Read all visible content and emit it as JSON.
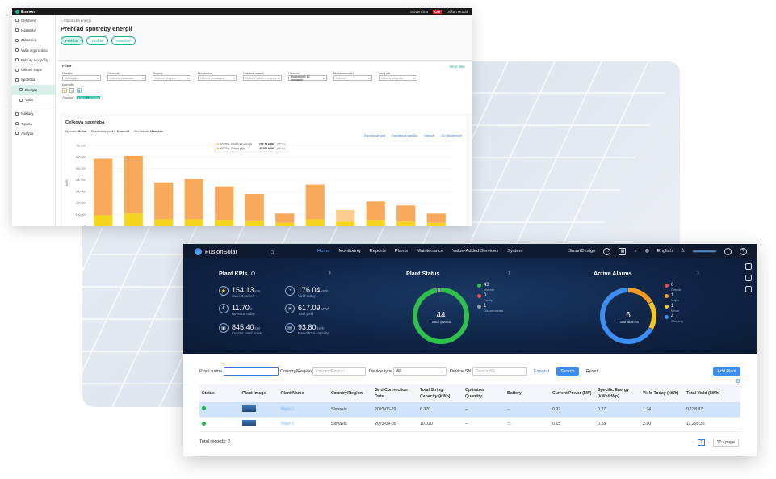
{
  "enmon": {
    "logo": "Enmon",
    "top_right": {
      "lang": "Slovenčina",
      "badge": "ON",
      "user": "Dušan Hudák"
    },
    "sidebar": [
      {
        "label": "Obľúbené"
      },
      {
        "label": "Nástenky"
      },
      {
        "label": "Zákazníci"
      },
      {
        "label": "Vaša organizácia"
      },
      {
        "label": "Faktúry a odpočty"
      },
      {
        "label": "Útlkové stupe"
      },
      {
        "label": "Spotreba"
      },
      {
        "label": "Energia"
      },
      {
        "label": "Voda"
      },
      {
        "label": "Nákłady"
      },
      {
        "label": "Toplota"
      },
      {
        "label": "Analýza"
      }
    ],
    "breadcrumb": "Spotreba energii",
    "title": "Prehľad spotreby energii",
    "tabs": [
      "Prehľad",
      "Využitie",
      "Mesačne"
    ],
    "filter": {
      "title": "Filter",
      "hide": "Skryť filter",
      "fields": [
        {
          "label": "Meradlo",
          "value": "Vyhľadajte..."
        },
        {
          "label": "Zákazník",
          "value": "Vyberte zákazníka"
        },
        {
          "label": "Skupiny",
          "value": "Vyberte skupinu"
        },
        {
          "label": "Prevádzka",
          "value": "Vyberte prevádzku"
        },
        {
          "label": "Odberné miesta",
          "value": "Vyberte odberné miesta"
        },
        {
          "label": "Obdobie",
          "value": "Posledných 12 mesiacov"
        },
        {
          "label": "Prevádzkovateľ",
          "value": "Vyberte"
        },
        {
          "label": "Zdroj dát",
          "value": "Vyberte zdroj dát"
        }
      ],
      "komodity_label": "Komodity",
      "obdobie_label": "Obdobie:",
      "obdobie_value": "1/2024 - 12/2024"
    },
    "card": {
      "title": "Celková spotreba",
      "options": [
        {
          "label": "Vypočet:",
          "value": "Suma"
        },
        {
          "label": "Rozdelenie podľa:",
          "value": "Komodít"
        },
        {
          "label": "Rozlíšenie:",
          "value": "Mesačne"
        }
      ],
      "actions": [
        "Exportovať graf",
        "Exportovať tabuľku",
        "Obnoviť",
        "Do oblúbených"
      ]
    },
    "chart_data": {
      "type": "bar",
      "ylabel": "kWh",
      "ylim": [
        0,
        700000
      ],
      "yticks": [
        "0",
        "100 000",
        "200 000",
        "300 000",
        "400 000",
        "500 000",
        "600 000",
        "700 000"
      ],
      "categories": [
        "1/2024",
        "2/2024",
        "3/2024",
        "4/2024",
        "5/2024",
        "6/2024",
        "7/2024",
        "8/2024",
        "9/2024",
        "10/2024",
        "11/2024",
        "12/2024"
      ],
      "series": [
        {
          "name": "Elektrická energia",
          "color": "#f5d51e",
          "values": [
            95000,
            110000,
            60000,
            60000,
            55000,
            50000,
            30000,
            60000,
            40000,
            55000,
            40000,
            30000
          ]
        },
        {
          "name": "Zemný plyn",
          "color": "#f8a95c",
          "values": [
            490000,
            500000,
            320000,
            350000,
            290000,
            230000,
            80000,
            300000,
            100000,
            160000,
            140000,
            80000
          ]
        }
      ],
      "tooltip": {
        "rows": [
          {
            "label": "9/2024 · Elektrická energia",
            "value": "222.78 kWh",
            "pct": "(35 %)"
          },
          {
            "label": "9/2024 · Zemný plyn",
            "value": "41 521 kWh",
            "pct": "(65 %)"
          }
        ]
      }
    }
  },
  "fusion": {
    "logo": "FusionSolar",
    "nav": [
      "Home",
      "Monitoring",
      "Reports",
      "Plants",
      "Maintenance",
      "Value-Added Services",
      "System"
    ],
    "top_right": {
      "smartdesign": "SmartDesign",
      "language": "English"
    },
    "kpis": {
      "title": "Plant KPIs",
      "items": [
        {
          "value": "154.13",
          "unit": "kW",
          "label": "Current power"
        },
        {
          "value": "176.04",
          "unit": "kWh",
          "label": "Yield today"
        },
        {
          "value": "11.70",
          "unit": "€",
          "label": "Revenue today"
        },
        {
          "value": "617.09",
          "unit": "MWh",
          "label": "Total yield"
        },
        {
          "value": "845.40",
          "unit": "kW",
          "label": "Inverter rated power"
        },
        {
          "value": "93.80",
          "unit": "kWh",
          "label": "Rated ESS capacity"
        }
      ]
    },
    "plant_status": {
      "title": "Plant Status",
      "total": "44",
      "total_label": "Total plants",
      "legend": [
        {
          "value": "43",
          "label": "Normal",
          "color": "#2fbf4a"
        },
        {
          "value": "0",
          "label": "Faulty",
          "color": "#e5484d"
        },
        {
          "value": "1",
          "label": "Disconnected",
          "color": "#9aa3ad"
        }
      ]
    },
    "alarms": {
      "title": "Active Alarms",
      "total": "6",
      "total_label": "Total alarms",
      "legend": [
        {
          "value": "0",
          "label": "Critical",
          "color": "#e5484d"
        },
        {
          "value": "1",
          "label": "Major",
          "color": "#f59a23"
        },
        {
          "value": "1",
          "label": "Minor",
          "color": "#f5c623"
        },
        {
          "value": "4",
          "label": "Warning",
          "color": "#3d8ef0"
        }
      ]
    },
    "search": {
      "plant_name_label": "Plant name",
      "country_label": "Country/Region",
      "country_placeholder": "Country/Region",
      "device_type_label": "Device type",
      "device_type_value": "All",
      "device_sn_label": "Device SN",
      "device_sn_placeholder": "Device SN",
      "expand": "Expand",
      "search_btn": "Search",
      "reset_btn": "Reset",
      "add_plant": "Add Plant"
    },
    "table": {
      "columns": [
        "Status",
        "Plant Image",
        "Plant Name",
        "Country/Region",
        "Grid Connection Date",
        "Total String Capacity (kWp)",
        "Optimizer Quantity",
        "Battery",
        "Current Power (kW)",
        "Specific Energy (kWh/kWp)",
        "Yield Today (kWh)",
        "Total Yield (kWh)"
      ],
      "rows": [
        {
          "name": "Plant 1",
          "country": "Slovakia",
          "date": "2023-06-29",
          "capacity": "6.370",
          "optimizer": "--",
          "battery": "--",
          "power": "0.92",
          "specific": "0.27",
          "yield_today": "1.74",
          "total_yield": "9,138.87"
        },
        {
          "name": "Plant 2",
          "country": "Slovakia",
          "date": "2023-04-05",
          "capacity": "10.010",
          "optimizer": "--",
          "battery": "",
          "power": "0.15",
          "specific": "0.28",
          "yield_today": "2.80",
          "total_yield": "11,295.35"
        }
      ]
    },
    "footer": {
      "total_records": "Total records: 2",
      "page": "1",
      "page_size": "10 / page"
    }
  }
}
